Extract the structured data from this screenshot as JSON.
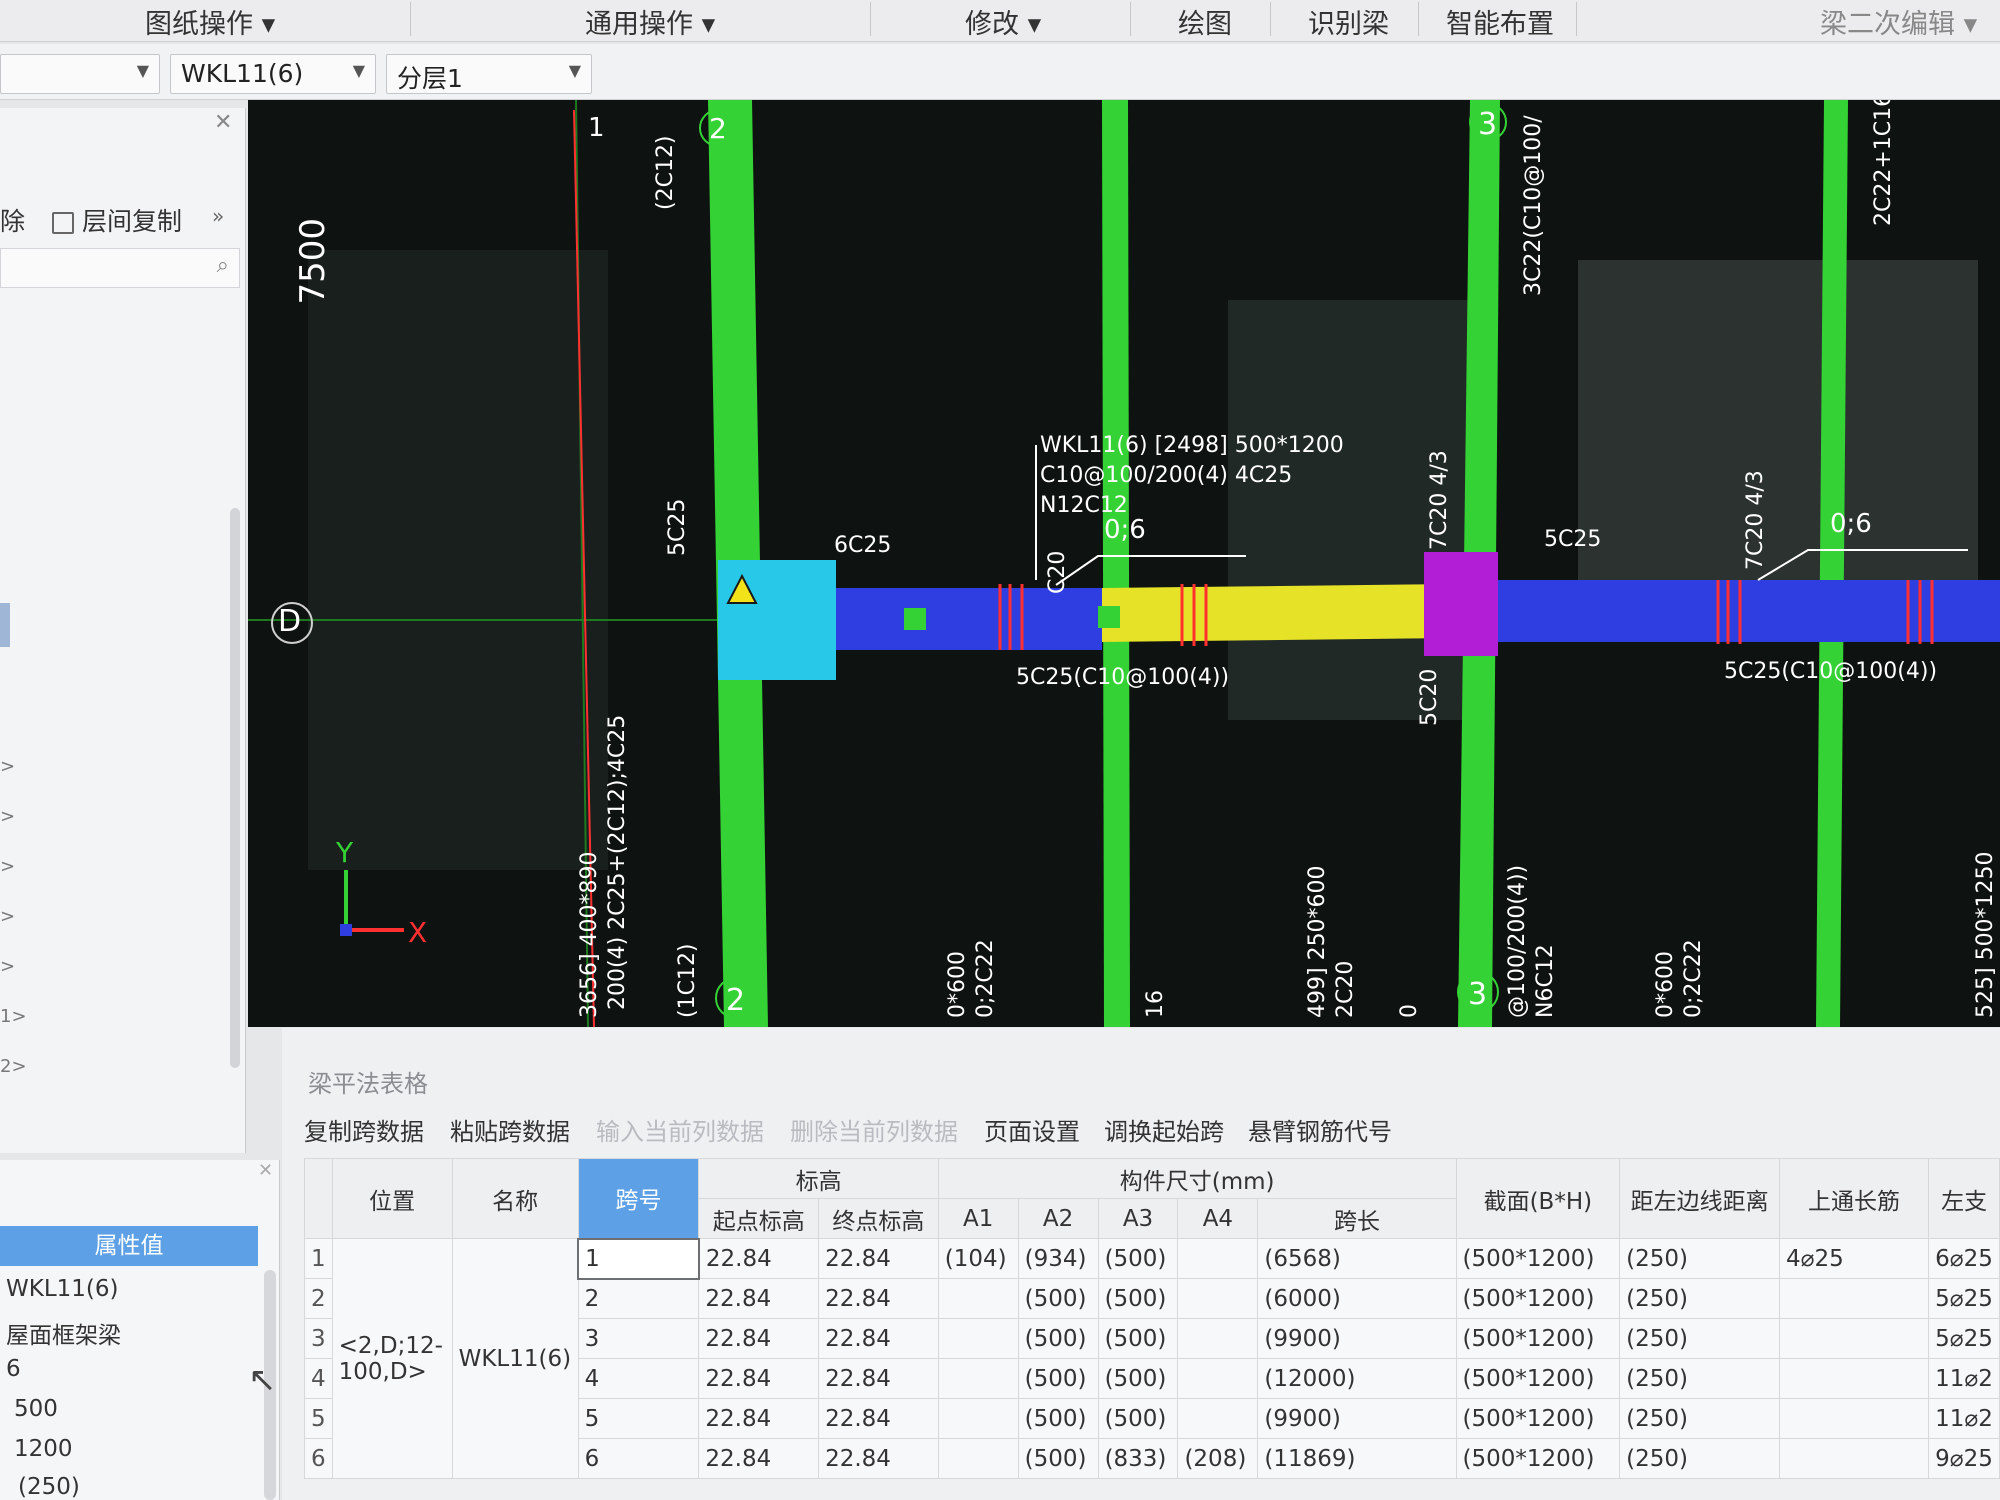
{
  "menu": {
    "items": [
      "图纸操作",
      "通用操作",
      "修改",
      "绘图",
      "识别梁",
      "智能布置",
      "梁二次编辑"
    ]
  },
  "selectors": {
    "combo_empty": "",
    "beam": "WKL11(6)",
    "layer": "分层1"
  },
  "left_panel": {
    "delete_label": "除",
    "copy_label": "层间复制",
    "tree_markers": [
      ">",
      ">",
      ">",
      ">",
      ">",
      "1>",
      "2>"
    ]
  },
  "props_panel": {
    "header": "属性值",
    "values": [
      "WKL11(6)",
      "屋面框架梁",
      "6",
      "500",
      "1200",
      "(250)"
    ]
  },
  "canvas": {
    "axis_labels": {
      "col_1": "1",
      "col_2_top": "2",
      "col_2_bottom": "2",
      "col_3_top": "3",
      "col_3_bottom": "3",
      "row_d": "D",
      "dim_7500": "7500",
      "ucs_x": "X",
      "ucs_y": "Y"
    },
    "annotations": {
      "beam_title": "WKL11(6) [2498] 500*1200",
      "beam_stirrup": "C10@100/200(4) 4C25",
      "beam_waist": "N12C12",
      "top_left_6c25": "6C25",
      "left_5c25": "5C25",
      "mid_5c25": "5C25(C10@100(4))",
      "right_5c25_top": "5C25",
      "right_bottom": "5C25(C10@100(4))",
      "seg_7c20": "7C20 4/3",
      "seg_7c20_right": "7C20 4/3",
      "seg_06_a": "0;6",
      "seg_06_b": "0;6",
      "v_2c12": "(2C12)",
      "v_3c22": "3C22(C10@100/",
      "v_2c22": "2C22+1C16",
      "v_5c20": "5C20",
      "v_c20": "C20",
      "v_left_long": "200(4) 2C25+(2C12);4C25",
      "v_left_size": "3656] 400*890",
      "v_1c12": "(1C12)",
      "v_600a": "0*600",
      "v_2c22a": "0;2C22",
      "v_16": "16",
      "v_250": "499] 250*600",
      "v_2c20": "2C20",
      "v_0": "0",
      "v_right_stir": "@100/200(4))",
      "v_n6c12": "N6C12",
      "v_600b": "0*600",
      "v_2c22b": "0;2C22",
      "v_1250": "525] 500*1250"
    }
  },
  "beam_panel": {
    "title": "梁平法表格",
    "toolbar": [
      "复制跨数据",
      "粘贴跨数据",
      "输入当前列数据",
      "删除当前列数据",
      "页面设置",
      "调换起始跨",
      "悬臂钢筋代号"
    ],
    "headers": {
      "position": "位置",
      "name": "名称",
      "span_no": "跨号",
      "elevation": "标高",
      "start_elev": "起点标高",
      "end_elev": "终点标高",
      "dims": "构件尺寸(mm)",
      "a1": "A1",
      "a2": "A2",
      "a3": "A3",
      "a4": "A4",
      "span_len": "跨长",
      "section": "截面(B*H)",
      "left_dist": "距左边线距离",
      "top_bar": "上通长筋",
      "left_support": "左支"
    },
    "position_value": "<2,D;12-100,D>",
    "name_value": "WKL11(6)",
    "top_bar_value": "4⌀25",
    "rows": [
      {
        "n": "1",
        "span": "1",
        "start": "22.84",
        "end": "22.84",
        "a1": "(104)",
        "a2": "(934)",
        "a3": "(500)",
        "a4": "",
        "len": "(6568)",
        "sec": "(500*1200)",
        "dist": "(250)",
        "left": "6⌀25"
      },
      {
        "n": "2",
        "span": "2",
        "start": "22.84",
        "end": "22.84",
        "a1": "",
        "a2": "(500)",
        "a3": "(500)",
        "a4": "",
        "len": "(6000)",
        "sec": "(500*1200)",
        "dist": "(250)",
        "left": "5⌀25"
      },
      {
        "n": "3",
        "span": "3",
        "start": "22.84",
        "end": "22.84",
        "a1": "",
        "a2": "(500)",
        "a3": "(500)",
        "a4": "",
        "len": "(9900)",
        "sec": "(500*1200)",
        "dist": "(250)",
        "left": "5⌀25"
      },
      {
        "n": "4",
        "span": "4",
        "start": "22.84",
        "end": "22.84",
        "a1": "",
        "a2": "(500)",
        "a3": "(500)",
        "a4": "",
        "len": "(12000)",
        "sec": "(500*1200)",
        "dist": "(250)",
        "left": "11⌀2"
      },
      {
        "n": "5",
        "span": "5",
        "start": "22.84",
        "end": "22.84",
        "a1": "",
        "a2": "(500)",
        "a3": "(500)",
        "a4": "",
        "len": "(9900)",
        "sec": "(500*1200)",
        "dist": "(250)",
        "left": "11⌀2"
      },
      {
        "n": "6",
        "span": "6",
        "start": "22.84",
        "end": "22.84",
        "a1": "",
        "a2": "(500)",
        "a3": "(833)",
        "a4": "(208)",
        "len": "(11869)",
        "sec": "(500*1200)",
        "dist": "(250)",
        "left": "9⌀25"
      }
    ]
  }
}
